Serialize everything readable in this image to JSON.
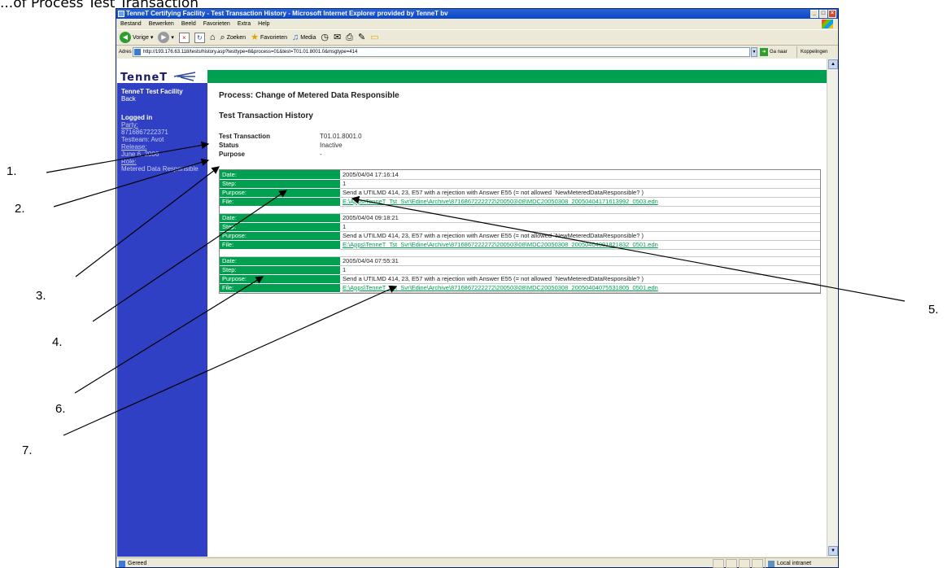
{
  "page_heading_partial": "...of Process Test Transaction",
  "browser": {
    "title": "TenneT Certifying Facility - Test Transaction History - Microsoft Internet Explorer provided by TenneT bv",
    "menu": [
      "Bestand",
      "Bewerken",
      "Beeld",
      "Favorieten",
      "Extra",
      "Help"
    ],
    "toolbar": {
      "back": "Vorige",
      "search": "Zoeken",
      "favorites": "Favorieten",
      "media": "Media"
    },
    "address_label": "Adres",
    "address_url": "http://193.176.63.118/tests/history.asp?testtype=8&process=01&test=T01.01.8001.0&msgtype=414",
    "go": "Ga naar",
    "links": "Koppelingen",
    "status": "Gereed",
    "zone": "Local intranet"
  },
  "site": {
    "logo": "TenneT",
    "sidebar": {
      "title": "TenneT Test Facility",
      "back": "Back",
      "logged_in": "Logged in",
      "party_label": "Party:",
      "party_value": "8716867222371",
      "testteam": "Testteam: Avot",
      "release_label": "Release:",
      "release_value": "June 6, 2006",
      "role_label": "Role:",
      "role_value": "Metered Data Responsible"
    }
  },
  "main": {
    "process_title": "Process: Change of Metered Data Responsible",
    "history_title": "Test Transaction History",
    "info": [
      {
        "label": "Test Transaction",
        "value": "T01.01.8001.0"
      },
      {
        "label": "Status",
        "value": "Inactive"
      },
      {
        "label": "Purpose",
        "value": "-"
      }
    ],
    "row_labels": {
      "date": "Date:",
      "step": "Step:",
      "purpose": "Purpose:",
      "file": "File:"
    },
    "history": [
      {
        "date": "2005/04/04 17:16:14",
        "step": "1",
        "purpose": "Send a UTILMD 414, 23, E57 with a rejection with Answer E55 (= not allowed `NewMeteredDataResponsible? )",
        "file": "E:\\Apps\\TenneT_Tst_Svr\\Edine\\Archive\\8716867222272\\200503\\08\\MDC20050308_20050404171613992_0503.edn"
      },
      {
        "date": "2005/04/04 09:18:21",
        "step": "1",
        "purpose": "Send a UTILMD 414, 23, E57 with a rejection with Answer E55 (= not allowed `NewMeteredDataResponsible? )",
        "file": "E:\\Apps\\TenneT_Tst_Svr\\Edine\\Archive\\8716867222272\\200503\\08\\MDC20050308_20050404091821832_0501.edn"
      },
      {
        "date": "2005/04/04 07:55:31",
        "step": "1",
        "purpose": "Send a UTILMD 414, 23, E57 with a rejection with Answer E55 (= not allowed `NewMeteredDataResponsible? )",
        "file": "E:\\Apps\\TenneT_Tst_Svr\\Edine\\Archive\\8716867222272\\200503\\08\\MDC20050308_20050404075531805_0501.edn"
      }
    ]
  },
  "callouts": [
    "1.",
    "2.",
    "3.",
    "4.",
    "5.",
    "6.",
    "7."
  ]
}
